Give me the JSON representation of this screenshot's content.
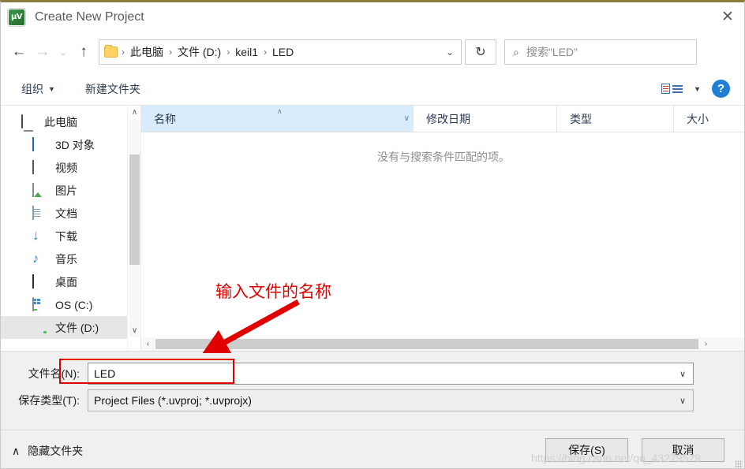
{
  "window": {
    "title": "Create New Project",
    "app_icon": "keil-uvision-icon",
    "close_label": "✕"
  },
  "navbar": {
    "back_icon": "←",
    "forward_icon": "→",
    "recent_icon": "⌄",
    "up_icon": "↑",
    "breadcrumb": [
      "此电脑",
      "文件 (D:)",
      "keil1",
      "LED"
    ],
    "breadcrumb_separator": "›",
    "address_chevron": "⌄",
    "refresh_icon": "↻",
    "search_placeholder": "搜索\"LED\"",
    "search_icon": "⌕"
  },
  "toolbar": {
    "organize_label": "组织",
    "organize_caret": "▼",
    "new_folder_label": "新建文件夹",
    "view_mode_caret": "▼",
    "help_label": "?"
  },
  "sidebar": {
    "items": [
      {
        "label": "此电脑",
        "icon": "this-pc-icon",
        "indent": false,
        "selected": false
      },
      {
        "label": "3D 对象",
        "icon": "3d-objects-icon",
        "indent": true,
        "selected": false
      },
      {
        "label": "视频",
        "icon": "videos-icon",
        "indent": true,
        "selected": false
      },
      {
        "label": "图片",
        "icon": "pictures-icon",
        "indent": true,
        "selected": false
      },
      {
        "label": "文档",
        "icon": "documents-icon",
        "indent": true,
        "selected": false
      },
      {
        "label": "下载",
        "icon": "downloads-icon",
        "indent": true,
        "selected": false
      },
      {
        "label": "音乐",
        "icon": "music-icon",
        "indent": true,
        "selected": false
      },
      {
        "label": "桌面",
        "icon": "desktop-icon",
        "indent": true,
        "selected": false
      },
      {
        "label": "OS (C:)",
        "icon": "os-drive-icon",
        "indent": true,
        "selected": false
      },
      {
        "label": "文件 (D:)",
        "icon": "drive-icon",
        "indent": true,
        "selected": true
      }
    ],
    "scroll_up_icon": "∧",
    "scroll_down_icon": "∨"
  },
  "filelist": {
    "columns": [
      {
        "label": "名称",
        "active": true,
        "sort": "∧",
        "chevron": "∨"
      },
      {
        "label": "修改日期",
        "active": false,
        "sort": "",
        "chevron": ""
      },
      {
        "label": "类型",
        "active": false,
        "sort": "",
        "chevron": ""
      },
      {
        "label": "大小",
        "active": false,
        "sort": "",
        "chevron": ""
      }
    ],
    "empty_message": "没有与搜索条件匹配的项。",
    "hscroll_left_icon": "‹",
    "hscroll_right_icon": "›"
  },
  "form": {
    "filename_label": "文件名(N):",
    "filename_value": "LED",
    "filetype_label": "保存类型(T):",
    "filetype_value": "Project Files (*.uvproj; *.uvprojx)",
    "chevron": "∨",
    "highlight_color": "#e00000"
  },
  "footer": {
    "hide_folders_caret": "∧",
    "hide_folders_label": "隐藏文件夹",
    "save_label": "保存(S)",
    "cancel_label": "取消"
  },
  "annotation": {
    "text": "输入文件的名称",
    "color": "#e00000"
  },
  "watermark": {
    "text": "https://blog.csdn.net/qq_43279579"
  }
}
